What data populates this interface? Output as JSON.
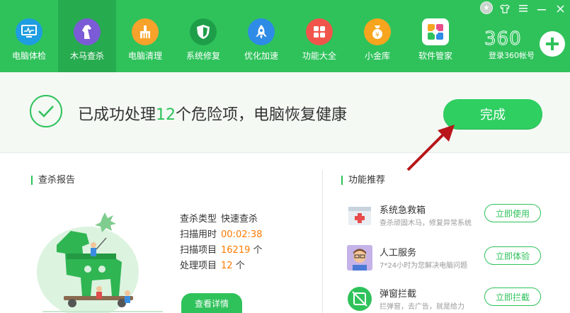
{
  "nav": {
    "items": [
      {
        "label": "电脑体检",
        "icon": "monitor-check-icon",
        "color": "#1e9de0"
      },
      {
        "label": "木马查杀",
        "icon": "horse-icon",
        "color": "#7b5bd6"
      },
      {
        "label": "电脑清理",
        "icon": "broom-icon",
        "color": "#f7a22a"
      },
      {
        "label": "系统修复",
        "icon": "shield-icon",
        "color": "#1f9e4a"
      },
      {
        "label": "优化加速",
        "icon": "rocket-icon",
        "color": "#2e8be6"
      },
      {
        "label": "功能大全",
        "icon": "grid-icon",
        "color": "#f0554b"
      },
      {
        "label": "小金库",
        "icon": "coin-icon",
        "color": "#f7a51e"
      },
      {
        "label": "软件管家",
        "icon": "software-icon",
        "color": "#ffffff"
      }
    ],
    "active_index": 1
  },
  "brand": {
    "logo": "360",
    "account": "登录360帐号"
  },
  "status": {
    "prefix": "已成功处理",
    "count": "12",
    "suffix": "个危险项，电脑恢复健康",
    "done_label": "完成"
  },
  "report": {
    "title": "查杀报告",
    "rows": [
      {
        "key": "查杀类型",
        "value": "快速查杀",
        "highlight": false
      },
      {
        "key": "扫描用时",
        "value": "00:02:38",
        "highlight": true
      },
      {
        "key": "扫描项目",
        "value": "16219",
        "unit": "个",
        "highlight": true
      },
      {
        "key": "处理项目",
        "value": "12",
        "unit": "个",
        "highlight": true
      }
    ],
    "detail_label": "查看详情"
  },
  "recommend": {
    "title": "功能推荐",
    "items": [
      {
        "title": "系统急救箱",
        "desc": "查杀顽固木马，修复异常系统",
        "button": "立即使用",
        "icon": "first-aid-icon"
      },
      {
        "title": "人工服务",
        "desc": "7*24小时为您解决电脑问题",
        "button": "立即体验",
        "icon": "avatar-icon"
      },
      {
        "title": "弹窗拦截",
        "desc": "拦弹窗，去广告，就是给力",
        "button": "立即拦截",
        "icon": "popup-block-icon"
      }
    ]
  },
  "colors": {
    "brand_green": "#2fc25b",
    "highlight_orange": "#ff7a00",
    "arrow_red": "#b8161b"
  }
}
